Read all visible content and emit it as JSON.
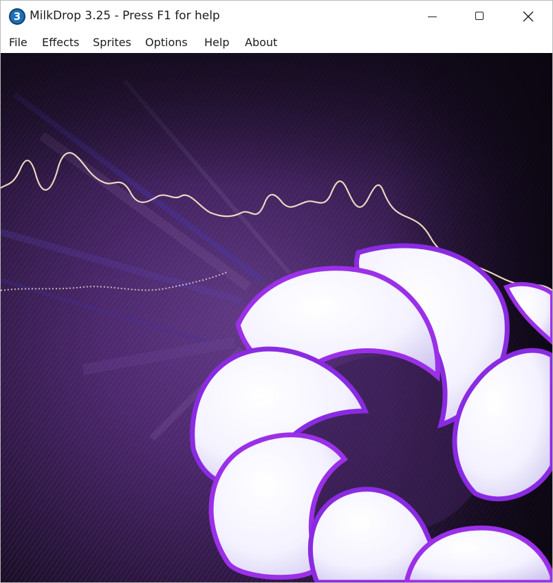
{
  "window": {
    "app_icon_glyph": "3",
    "title": "MilkDrop 3.25 - Press F1 for help",
    "controls": {
      "minimize_icon": "minimize-icon",
      "maximize_icon": "maximize-icon",
      "close_icon": "close-icon"
    }
  },
  "menu": {
    "items": [
      {
        "label": "File"
      },
      {
        "label": "Effects"
      },
      {
        "label": "Sprites"
      },
      {
        "label": "Options"
      },
      {
        "label": "Help"
      },
      {
        "label": "About"
      }
    ]
  },
  "visualization": {
    "colors": {
      "background_dark": "#0d0812",
      "purple_mid": "#6a3a96",
      "purple_light": "#b78ad8",
      "blue_streak": "#5a4cff",
      "waveform": "#f4e2c8",
      "ring_purple": "#8a2be2",
      "petal_white": "#fbfaff"
    }
  }
}
